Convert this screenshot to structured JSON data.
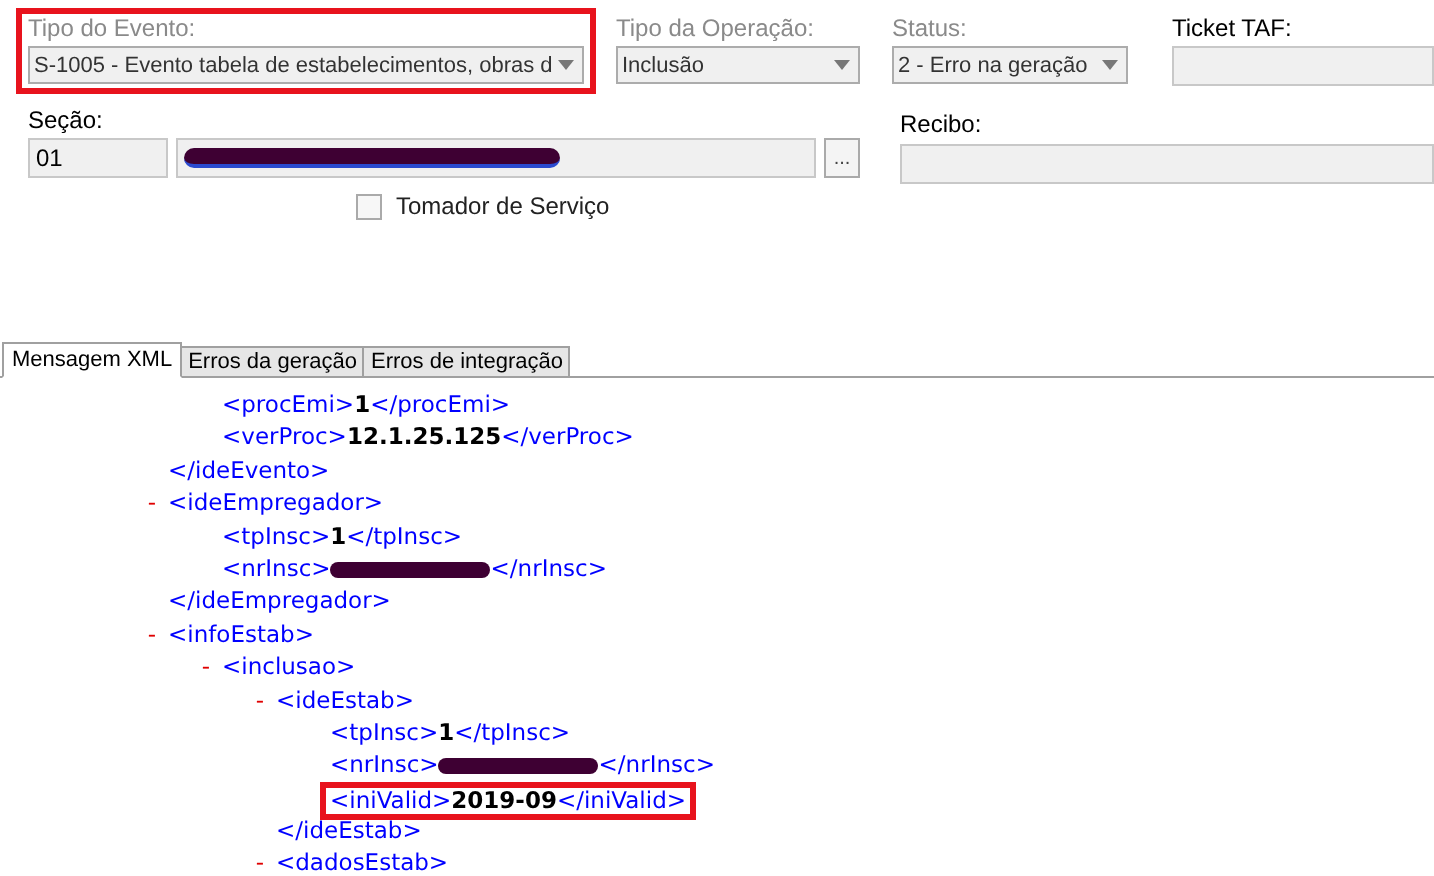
{
  "form": {
    "fields": [
      {
        "kind": "combo",
        "label": "Tipo do Evento:",
        "value": "S-1005 - Evento tabela de estabelecimentos, obras d",
        "disabled": true,
        "highlighted": true
      },
      {
        "kind": "combo",
        "label": "Tipo da Operação:",
        "value": "Inclusão",
        "disabled": true
      },
      {
        "kind": "combo",
        "label": "Status:",
        "value": "2 - Erro na geração",
        "disabled": true
      },
      {
        "kind": "text",
        "label": "Ticket TAF:",
        "disabled": false
      }
    ],
    "secao": {
      "label": "Seção:",
      "code": "01",
      "name_redacted": true,
      "lookup": "..."
    },
    "recibo": {
      "label": "Recibo:"
    },
    "tomador": {
      "label": "Tomador de Serviço",
      "checked": false
    }
  },
  "tabs": [
    {
      "label": "Mensagem XML",
      "selected": true
    },
    {
      "label": "Erros da geração",
      "selected": false
    },
    {
      "label": "Erros de integração",
      "selected": false
    }
  ],
  "xml": [
    {
      "kind": "element",
      "close": "</ideEvento>",
      "children": [
        {
          "kind": "leaf",
          "open": "<procEmi>",
          "value": "1",
          "close": "</procEmi>"
        },
        {
          "kind": "leaf",
          "open": "<verProc>",
          "value": "12.1.25.125",
          "close": "</verProc>"
        }
      ]
    },
    {
      "kind": "element",
      "toggle": "-",
      "open": "<ideEmpregador>",
      "close": "</ideEmpregador>",
      "children": [
        {
          "kind": "leaf",
          "open": "<tpInsc>",
          "value": "1",
          "close": "</tpInsc>"
        },
        {
          "kind": "leaf",
          "open": "<nrInsc>",
          "redacted": true,
          "close": "</nrInsc>"
        }
      ]
    },
    {
      "kind": "element",
      "toggle": "-",
      "open": "<infoEstab>",
      "children": [
        {
          "kind": "element",
          "toggle": "-",
          "open": "<inclusao>",
          "children": [
            {
              "kind": "element",
              "toggle": "-",
              "open": "<ideEstab>",
              "close": "</ideEstab>",
              "children": [
                {
                  "kind": "leaf",
                  "open": "<tpInsc>",
                  "value": "1",
                  "close": "</tpInsc>"
                },
                {
                  "kind": "leaf",
                  "open": "<nrInsc>",
                  "redacted": true,
                  "close": "</nrInsc>"
                },
                {
                  "kind": "leaf",
                  "open": "<iniValid>",
                  "value": "2019-09",
                  "close": "</iniValid>",
                  "highlighted": true
                }
              ]
            },
            {
              "kind": "element",
              "toggle": "-",
              "open": "<dadosEstab>"
            }
          ]
        }
      ]
    }
  ]
}
